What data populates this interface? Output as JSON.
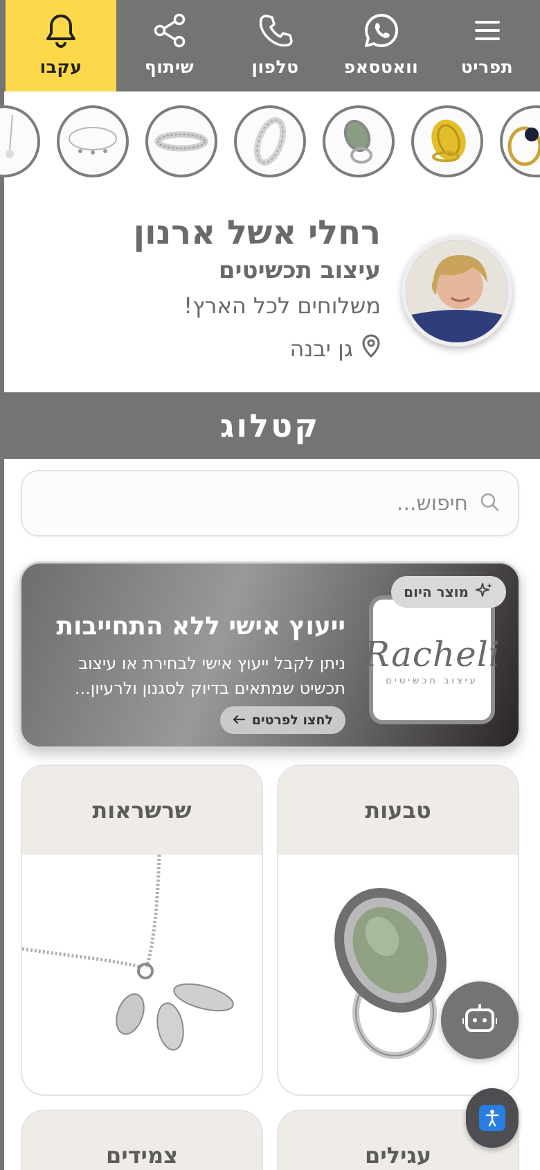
{
  "nav": {
    "menu_label": "תפריט",
    "whatsapp_label": "וואטסאפ",
    "phone_label": "טלפון",
    "share_label": "שיתוף",
    "follow_label": "עקבו"
  },
  "profile": {
    "name": "רחלי אשל ארנון",
    "subtitle": "עיצוב תכשיטים",
    "shipping": "משלוחים לכל הארץ!",
    "location": "גן יבנה"
  },
  "catalog": {
    "title": "קטלוג"
  },
  "search": {
    "placeholder": "חיפוש..."
  },
  "featured": {
    "badge": "מוצר היום",
    "title": "ייעוץ אישי ללא התחייבות",
    "description": "ניתן לקבל ייעוץ אישי לבחירת או עיצוב תכשיט שמתאים בדיוק לסגנון ולרעיון...",
    "button_label": "לחצו לפרטים",
    "logo_text": "Racheli",
    "logo_sub": "עיצוב תכשיטים"
  },
  "categories": [
    {
      "label": "טבעות"
    },
    {
      "label": "שרשראות"
    },
    {
      "label": "עגילים"
    },
    {
      "label": "צמידים"
    }
  ],
  "colors": {
    "nav_bg": "#757475",
    "follow_bg": "#fcd94a",
    "card_head_bg": "#efece7"
  }
}
